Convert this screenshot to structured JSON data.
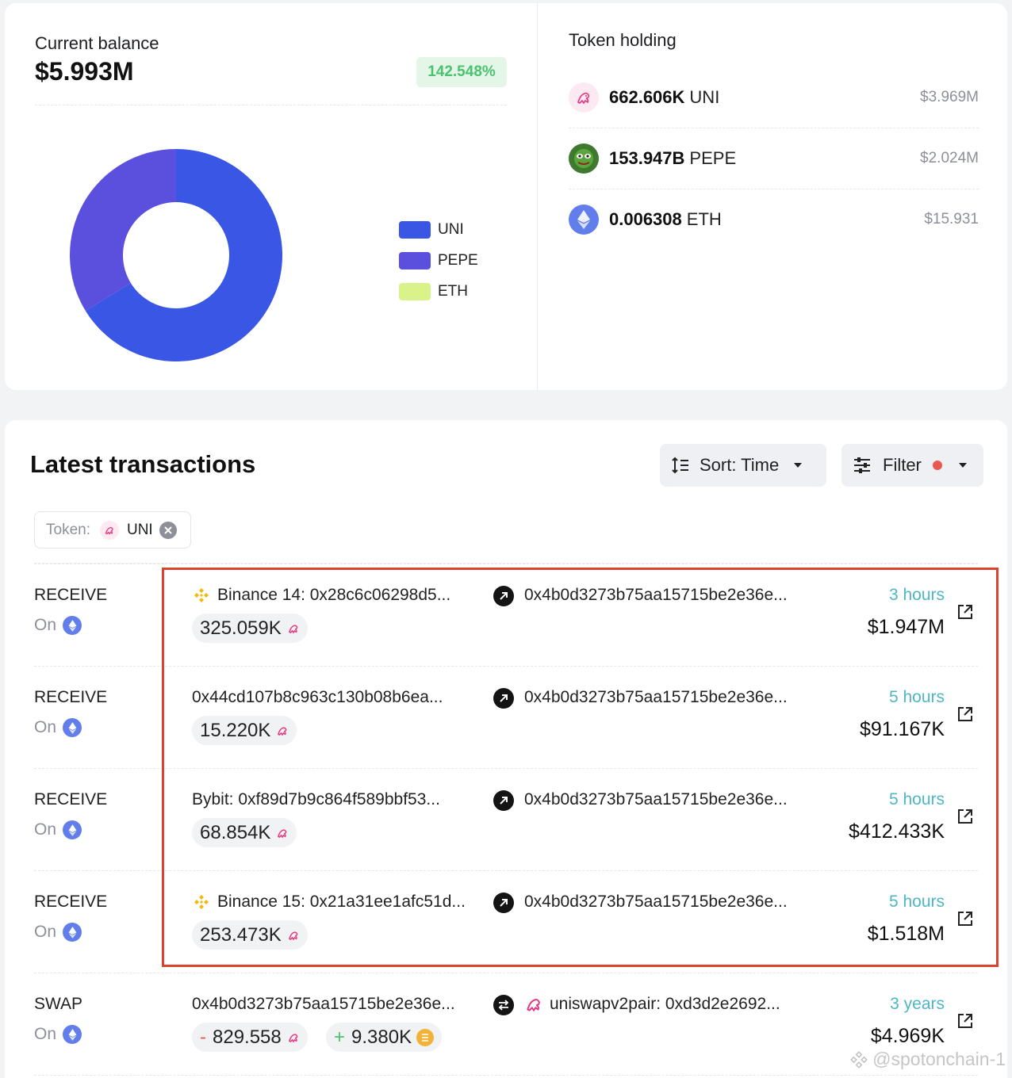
{
  "balance": {
    "label": "Current balance",
    "value": "$5.993M",
    "change": "142.548%"
  },
  "chart_data": {
    "type": "pie",
    "categories": [
      "UNI",
      "PEPE",
      "ETH"
    ],
    "values": [
      3.969,
      2.024,
      1.5931e-05
    ],
    "colors": [
      "#3a56e4",
      "#5b4fdd",
      "#d9f28a"
    ],
    "legend_position": "right"
  },
  "holdings": {
    "title": "Token holding",
    "items": [
      {
        "amount": "662.606K",
        "symbol": "UNI",
        "usd": "$3.969M",
        "icon": "uni-icon"
      },
      {
        "amount": "153.947B",
        "symbol": "PEPE",
        "usd": "$2.024M",
        "icon": "pepe-icon"
      },
      {
        "amount": "0.006308",
        "symbol": "ETH",
        "usd": "$15.931",
        "icon": "eth-icon"
      }
    ]
  },
  "transactions": {
    "title": "Latest transactions",
    "sort_label": "Sort: Time",
    "filter_label": "Filter",
    "token_filter": {
      "label": "Token:",
      "value": "UNI"
    },
    "on_label": "On",
    "rows": [
      {
        "type": "RECEIVE",
        "from": "Binance 14: 0x28c6c06298d5...",
        "from_icon": "binance-icon",
        "to": "0x4b0d3273b75aa15715be2e36e...",
        "amount": "325.059K",
        "time": "3 hours",
        "usd": "$1.947M"
      },
      {
        "type": "RECEIVE",
        "from": "0x44cd107b8c963c130b08b6ea...",
        "from_icon": "",
        "to": "0x4b0d3273b75aa15715be2e36e...",
        "amount": "15.220K",
        "time": "5 hours",
        "usd": "$91.167K"
      },
      {
        "type": "RECEIVE",
        "from": "Bybit: 0xf89d7b9c864f589bbf53...",
        "from_icon": "",
        "to": "0x4b0d3273b75aa15715be2e36e...",
        "amount": "68.854K",
        "time": "5 hours",
        "usd": "$412.433K"
      },
      {
        "type": "RECEIVE",
        "from": "Binance 15: 0x21a31ee1afc51d...",
        "from_icon": "binance-icon",
        "to": "0x4b0d3273b75aa15715be2e36e...",
        "amount": "253.473K",
        "time": "5 hours",
        "usd": "$1.518M"
      }
    ],
    "swap": {
      "type": "SWAP",
      "from": "0x4b0d3273b75aa15715be2e36e...",
      "to": "uniswapv2pair: 0xd3d2e2692...",
      "amount_out": "829.558",
      "amount_out_sign": "-",
      "amount_in": "9.380K",
      "amount_in_sign": "+",
      "time": "3 years",
      "usd": "$4.969K"
    }
  },
  "watermark": "@spotonchain-1"
}
